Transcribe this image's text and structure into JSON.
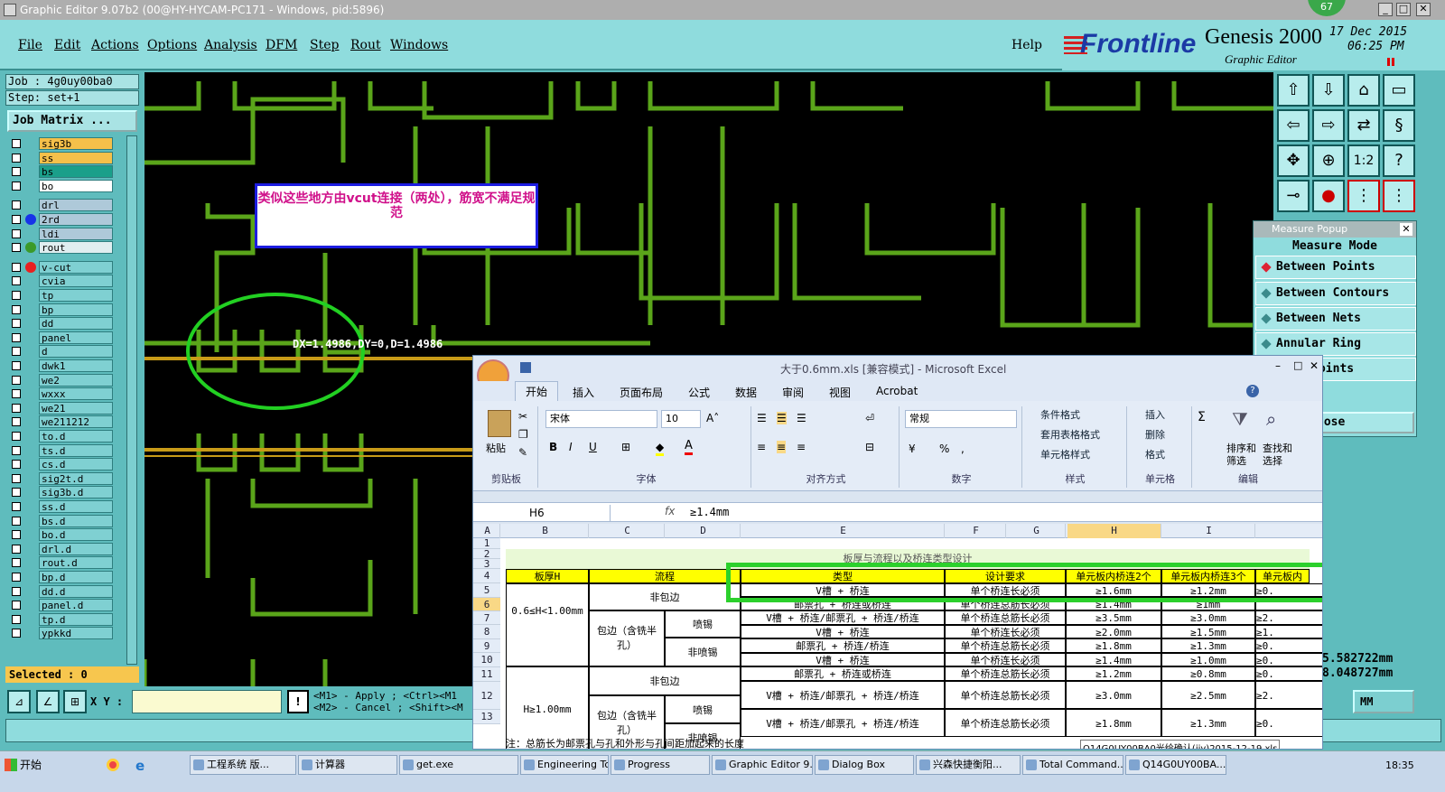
{
  "window": {
    "title": "Graphic Editor 9.07b2 (00@HY-HYCAM-PC171 - Windows, pid:5896)",
    "badge": "67"
  },
  "menu": {
    "items": [
      "File",
      "Edit",
      "Actions",
      "Options",
      "Analysis",
      "DFM",
      "Step",
      "Rout",
      "Windows"
    ],
    "help": "Help"
  },
  "brand": {
    "logo": "Frontline",
    "product": "Genesis 2000",
    "subtitle": "Graphic Editor",
    "date": "17 Dec 2015",
    "time": "06:25 PM"
  },
  "job": {
    "job_label": "Job : 4g0uy00ba0",
    "step_label": "Step: set+1",
    "matrix_button": "Job Matrix ..."
  },
  "layers": [
    {
      "name": "sig3b",
      "color": "#f5c04a"
    },
    {
      "name": "ss",
      "color": "#f5c04a"
    },
    {
      "name": "bs",
      "color": "#1a9f8a"
    },
    {
      "name": "bo",
      "color": "#ffffff"
    },
    {
      "name": "drl",
      "color": "#aec9d9"
    },
    {
      "name": "2rd",
      "color": "#aec9d9"
    },
    {
      "name": "ldi",
      "color": "#aec9d9"
    },
    {
      "name": "rout",
      "color": "#e0eef0"
    },
    {
      "name": "v-cut",
      "color": "#7fd0d2"
    },
    {
      "name": "cvia",
      "color": "#7fd0d2"
    },
    {
      "name": "tp",
      "color": "#7fd0d2"
    },
    {
      "name": "bp",
      "color": "#7fd0d2"
    },
    {
      "name": "dd",
      "color": "#7fd0d2"
    },
    {
      "name": "panel",
      "color": "#7fd0d2"
    },
    {
      "name": "d",
      "color": "#7fd0d2"
    },
    {
      "name": "dwk1",
      "color": "#7fd0d2"
    },
    {
      "name": "we2",
      "color": "#7fd0d2"
    },
    {
      "name": "wxxx",
      "color": "#7fd0d2"
    },
    {
      "name": "we21",
      "color": "#7fd0d2"
    },
    {
      "name": "we211212",
      "color": "#7fd0d2"
    },
    {
      "name": "to.d",
      "color": "#7fd0d2"
    },
    {
      "name": "ts.d",
      "color": "#7fd0d2"
    },
    {
      "name": "cs.d",
      "color": "#7fd0d2"
    },
    {
      "name": "sig2t.d",
      "color": "#7fd0d2"
    },
    {
      "name": "sig3b.d",
      "color": "#7fd0d2"
    },
    {
      "name": "ss.d",
      "color": "#7fd0d2"
    },
    {
      "name": "bs.d",
      "color": "#7fd0d2"
    },
    {
      "name": "bo.d",
      "color": "#7fd0d2"
    },
    {
      "name": "drl.d",
      "color": "#7fd0d2"
    },
    {
      "name": "rout.d",
      "color": "#7fd0d2"
    },
    {
      "name": "bp.d",
      "color": "#7fd0d2"
    },
    {
      "name": "dd.d",
      "color": "#7fd0d2"
    },
    {
      "name": "panel.d",
      "color": "#7fd0d2"
    },
    {
      "name": "tp.d",
      "color": "#7fd0d2"
    },
    {
      "name": "ypkkd",
      "color": "#7fd0d2"
    }
  ],
  "selected": "Selected : 0",
  "coords": {
    "label": "X Y :",
    "hint1": "<M1> - Apply ; <Ctrl><M1",
    "hint2": "<M2> - Cancel ; <Shift><M"
  },
  "canvas": {
    "annotation": "类似这些地方由vcut连接（两处），筋宽不满足规范",
    "measurement": "DX=1.4986,DY=0,D=1.4986"
  },
  "measure_popup": {
    "title": "Measure Popup",
    "mode": "Measure Mode",
    "options": [
      "Between Points",
      "Between Contours",
      "Between Nets",
      "Annular Ring",
      "n Midpoints"
    ],
    "close": "lose",
    "readout1": "5.582722mm",
    "readout2": "8.048727mm",
    "unit": "MM"
  },
  "excel": {
    "title": "大于0.6mm.xls  [兼容模式] - Microsoft Excel",
    "tabs": [
      "开始",
      "插入",
      "页面布局",
      "公式",
      "数据",
      "审阅",
      "视图",
      "Acrobat"
    ],
    "font_name": "宋体",
    "font_size": "10",
    "number_format": "常规",
    "ribbon_groups": [
      "剪贴板",
      "字体",
      "对齐方式",
      "数字",
      "样式",
      "单元格",
      "编辑"
    ],
    "ribbon_buttons": {
      "paste": "粘贴",
      "cond": "条件格式",
      "table": "套用表格格式",
      "cellstyle": "单元格样式",
      "insert": "插入",
      "delete": "删除",
      "format": "格式",
      "sort": "排序和筛选",
      "find": "查找和选择"
    },
    "name_box": "H6",
    "formula": "≥1.4mm",
    "columns": [
      "A",
      "B",
      "C",
      "D",
      "E",
      "F",
      "G",
      "H",
      "I"
    ],
    "rows": [
      "1",
      "2",
      "3",
      "4",
      "5",
      "6",
      "7",
      "8",
      "9",
      "10",
      "11",
      "12",
      "13",
      "14"
    ],
    "table_title": "板厚与流程以及桥连类型设计",
    "headers": [
      "板厚H",
      "流程",
      "类型",
      "设计要求",
      "单元板内桥连2个",
      "单元板内桥连3个",
      "单元板内"
    ],
    "thick1": "0.6≤H<1.00mm",
    "thick2": "H≥1.00mm",
    "flow_nowrap": "非包边",
    "flow_wrap": "包边（含铣半孔）",
    "spray": "喷锡",
    "nospray": "非喷锡",
    "data": [
      [
        "V槽 + 桥连",
        "单个桥连长必须",
        "≥1.6mm",
        "≥1.2mm",
        "≥0."
      ],
      [
        "邮票孔 + 桥连或桥连",
        "单个桥连总筋长必须",
        "≥1.4mm",
        "≥1mm",
        ""
      ],
      [
        "V槽 + 桥连/邮票孔 + 桥连/桥连",
        "单个桥连总筋长必须",
        "≥3.5mm",
        "≥3.0mm",
        "≥2."
      ],
      [
        "V槽 + 桥连",
        "单个桥连长必须",
        "≥2.0mm",
        "≥1.5mm",
        "≥1."
      ],
      [
        "邮票孔 + 桥连/桥连",
        "单个桥连总筋长必须",
        "≥1.8mm",
        "≥1.3mm",
        "≥0."
      ],
      [
        "V槽 + 桥连",
        "单个桥连长必须",
        "≥1.4mm",
        "≥1.0mm",
        "≥0."
      ],
      [
        "邮票孔 + 桥连或桥连",
        "单个桥连总筋长必须",
        "≥1.2mm",
        "≥0.8mm",
        "≥0."
      ],
      [
        "V槽 + 桥连/邮票孔 + 桥连/桥连",
        "单个桥连总筋长必须",
        "≥3.0mm",
        "≥2.5mm",
        "≥2."
      ],
      [
        "V槽 + 桥连/邮票孔 + 桥连/桥连",
        "单个桥连总筋长必须",
        "≥1.8mm",
        "≥1.3mm",
        "≥0."
      ]
    ],
    "note": "注：总筋长为邮票孔与孔和外形与孔间距加起来的长度",
    "tooltip": "Q14G0UY00BA0光绘确认(jjy)2015-12-19.xls"
  },
  "taskbar": {
    "start": "开始",
    "items": [
      "工程系统  版...",
      "计算器",
      "get.exe",
      "Engineering To...",
      "Progress",
      "Graphic Editor 9...",
      "Dialog Box",
      "兴森快捷衡阳...",
      "Total Command...",
      "Q14G0UY00BA..."
    ],
    "clock": "18:35"
  }
}
